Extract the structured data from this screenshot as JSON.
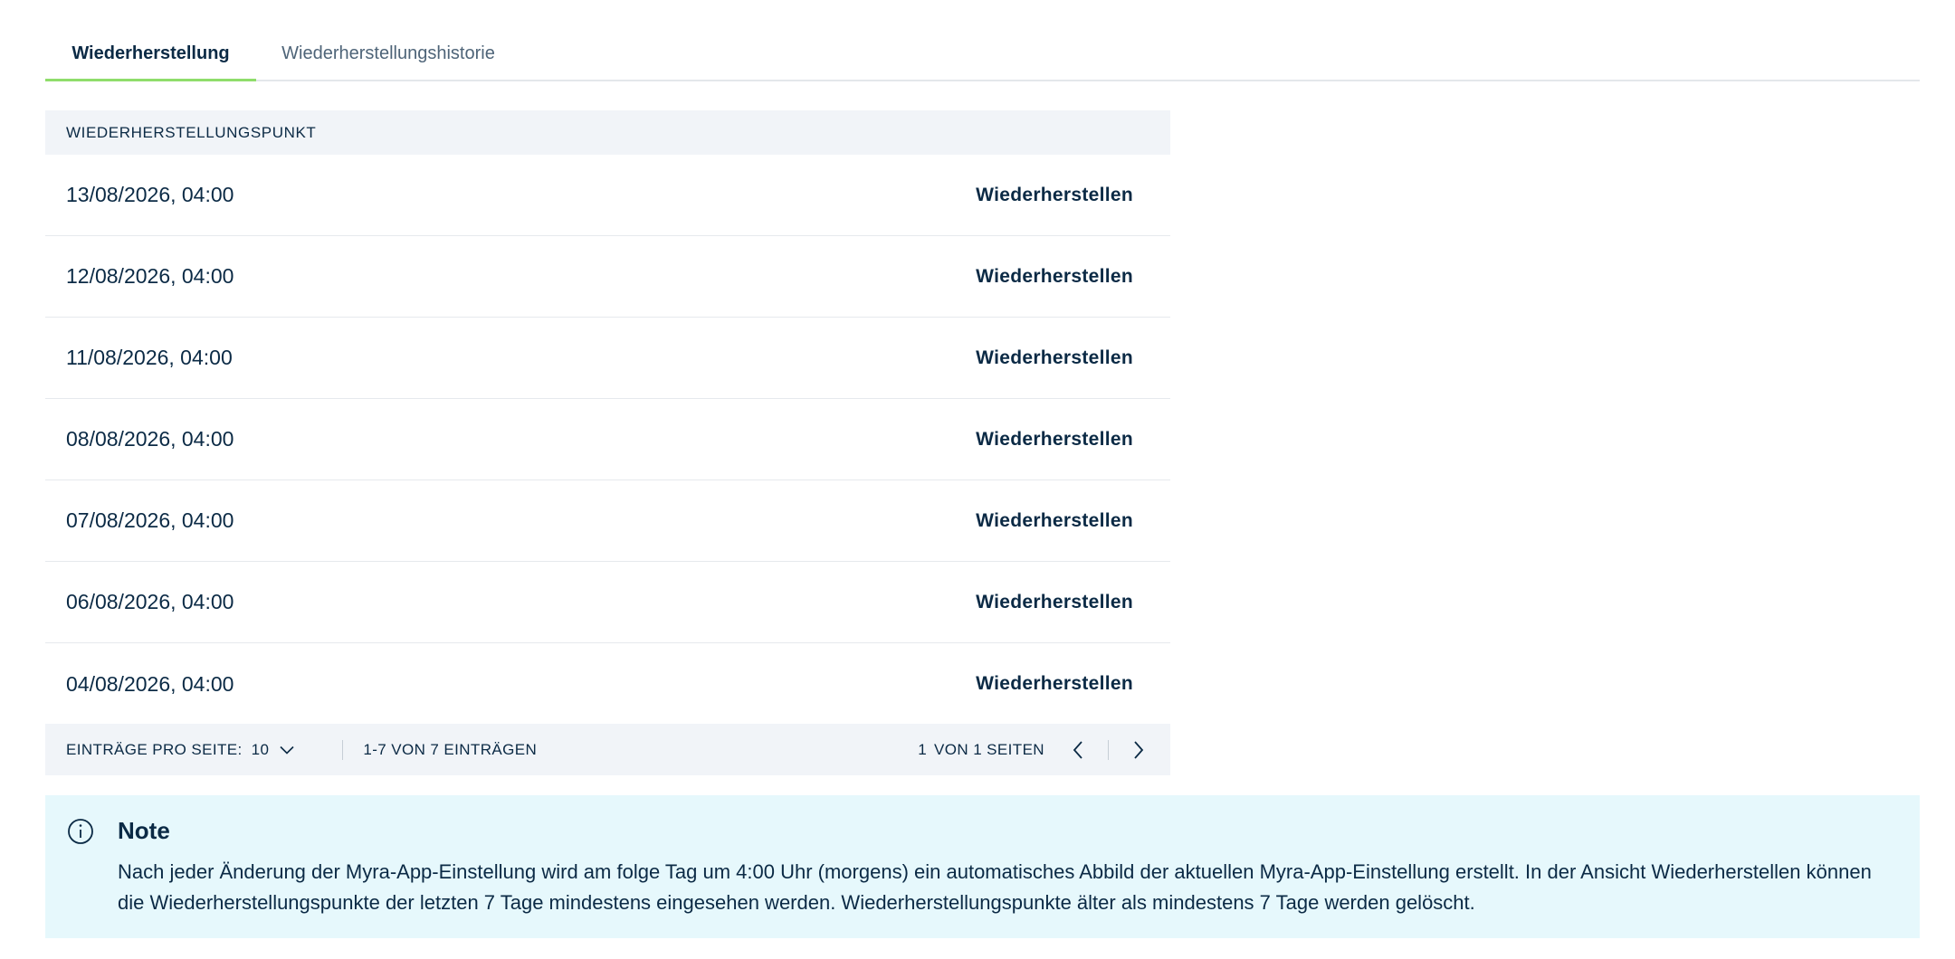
{
  "tabs": [
    {
      "label": "Wiederherstellung",
      "active": true
    },
    {
      "label": "Wiederherstellungshistorie",
      "active": false
    }
  ],
  "table": {
    "header": "WIEDERHERSTELLUNGSPUNKT",
    "rows": [
      {
        "date": "13/08/2026, 04:00",
        "action": "Wiederherstellen"
      },
      {
        "date": "12/08/2026, 04:00",
        "action": "Wiederherstellen"
      },
      {
        "date": "11/08/2026, 04:00",
        "action": "Wiederherstellen"
      },
      {
        "date": "08/08/2026, 04:00",
        "action": "Wiederherstellen"
      },
      {
        "date": "07/08/2026, 04:00",
        "action": "Wiederherstellen"
      },
      {
        "date": "06/08/2026, 04:00",
        "action": "Wiederherstellen"
      },
      {
        "date": "04/08/2026, 04:00",
        "action": "Wiederherstellen"
      }
    ]
  },
  "pagination": {
    "per_page_label": "EINTRÄGE PRO SEITE:",
    "per_page_value": "10",
    "range_text": "1-7 VON 7 EINTRÄGEN",
    "page_current": "1",
    "page_text": "VON 1 SEITEN"
  },
  "note": {
    "title": "Note",
    "text": "Nach jeder Änderung der Myra-App-Einstellung wird am folge Tag um 4:00 Uhr (morgens) ein automatisches Abbild der aktuellen Myra-App-Einstellung erstellt. In der Ansicht Wiederherstellen können die Wiederherstellungspunkte der letzten 7 Tage mindestens eingesehen werden. Wiederherstellungspunkte älter als mindestens 7 Tage werden gelöscht."
  },
  "colors": {
    "text": "#0b2a45",
    "tab_active_underline": "#8fdd6b",
    "table_header_bg": "#f1f4f8",
    "note_bg": "#e6f8fc"
  },
  "icons": {
    "per_page": "chevron-down-icon",
    "prev": "chevron-left-icon",
    "next": "chevron-right-icon",
    "note": "info-icon"
  }
}
